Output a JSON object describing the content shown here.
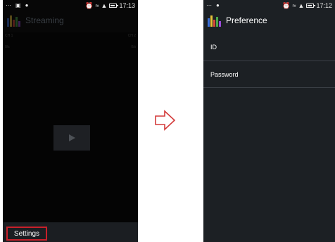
{
  "left_screen": {
    "status_bar": {
      "icons_left": [
        "more-icon",
        "image-icon",
        "chat-icon"
      ],
      "icons_right": [
        "alarm-icon",
        "wifi-icon",
        "signal-icon",
        "battery-icon"
      ],
      "time": "17:13"
    },
    "app_bar": {
      "title": "Streaming",
      "icon": "app-logo-icon"
    },
    "channel_labels": {
      "top_left": "CH 1",
      "top_right": "CH 2",
      "sub_left": "0/s",
      "sub_right": "0/s"
    },
    "video": {
      "icon": "play-icon"
    },
    "bottom_bar": {
      "settings_label": "Settings",
      "highlight_color": "#c8202a"
    }
  },
  "right_screen": {
    "status_bar": {
      "icons_left": [
        "more-icon",
        "chat-icon"
      ],
      "icons_right": [
        "alarm-icon",
        "wifi-icon",
        "signal-icon",
        "battery-icon"
      ],
      "time": "17:12"
    },
    "app_bar": {
      "title": "Preference",
      "icon": "app-logo-icon"
    },
    "preferences": [
      {
        "label": "ID"
      },
      {
        "label": "Password"
      }
    ]
  },
  "transition": {
    "icon": "arrow-right-icon"
  },
  "colors": {
    "left_bg": "#070707",
    "right_bg": "#1c2024",
    "highlight": "#c8202a"
  }
}
